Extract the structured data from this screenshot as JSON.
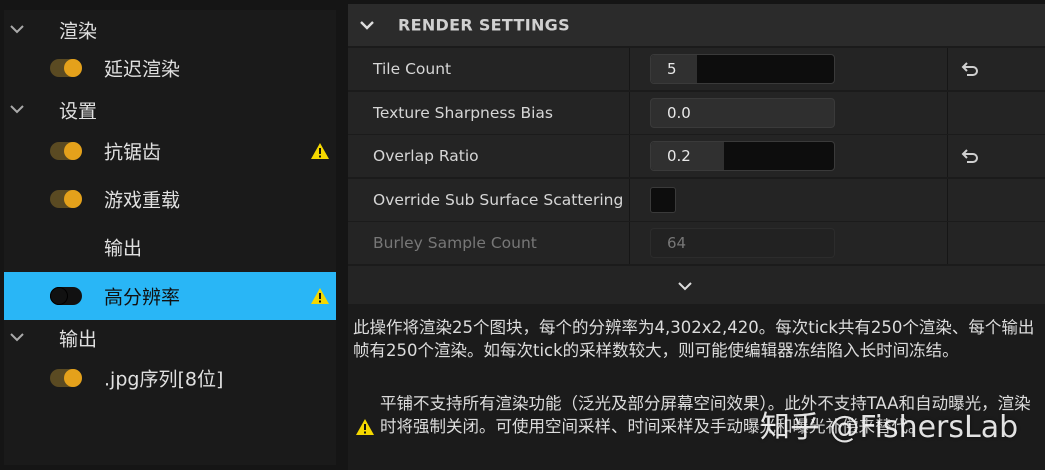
{
  "sidebar": {
    "sections": [
      {
        "label": "渲染",
        "items": [
          {
            "label": "延迟渲染",
            "toggle": "on",
            "warning": false
          }
        ]
      },
      {
        "label": "设置",
        "items": [
          {
            "label": "抗锯齿",
            "toggle": "on",
            "warning": true
          },
          {
            "label": "游戏重载",
            "toggle": "on",
            "warning": false
          },
          {
            "label": "输出",
            "toggle": "none",
            "warning": false
          },
          {
            "label": "高分辨率",
            "toggle": "off",
            "warning": true,
            "selected": true
          }
        ]
      },
      {
        "label": "输出",
        "items": [
          {
            "label": ".jpg序列[8位]",
            "toggle": "on",
            "warning": false
          }
        ]
      }
    ]
  },
  "panel": {
    "title": "RENDER SETTINGS",
    "properties": [
      {
        "name": "Tile Count",
        "value": "5",
        "fill_fraction": 0.25,
        "reset": true
      },
      {
        "name": "Texture Sharpness Bias",
        "value": "0.0",
        "reset": false
      },
      {
        "name": "Overlap Ratio",
        "value": "0.2",
        "fill_fraction": 0.4,
        "reset": true
      },
      {
        "name": "Override Sub Surface Scattering",
        "checked": false
      },
      {
        "name": "Burley Sample Count",
        "value": "64",
        "disabled": true
      }
    ],
    "description": "此操作将渲染25个图块，每个的分辨率为4,302x2,420。每次tick共有250个渲染、每个输出帧有250个渲染。如每次tick的采样数较大，则可能使编辑器冻结陷入长时间冻结。",
    "warning_text": "平铺不支持所有渲染功能（泛光及部分屏幕空间效果）。此外不支持TAA和自动曝光，渲染时将强制关闭。可使用空间采样、时间采样及手动曝光和曝光补偿来替代。"
  },
  "watermark": "知乎 @FishersLab",
  "colors": {
    "accent_selected": "#29b6f6",
    "toggle_on": "#e4a11b",
    "warning": "#f5d800"
  }
}
